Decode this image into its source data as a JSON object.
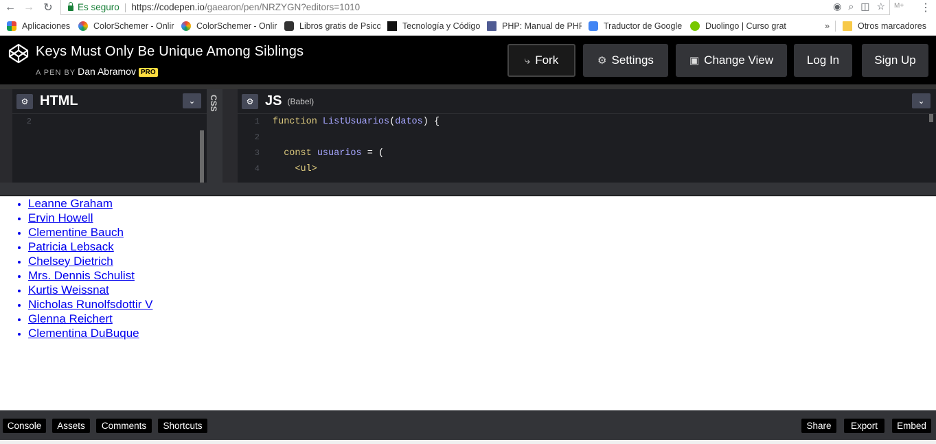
{
  "browser": {
    "secure_label": "Es seguro",
    "url_host": "https://codepen.io",
    "url_path": "/gaearon/pen/NRZYGN?editors=1010",
    "bookmarks": [
      {
        "label": "Aplicaciones",
        "color": "#e8453c"
      },
      {
        "label": "ColorSchemer - Onlir",
        "color": "#f4b400"
      },
      {
        "label": "ColorSchemer - Onlir",
        "color": "#f4b400"
      },
      {
        "label": "Libros gratis de Psico",
        "color": "#333333"
      },
      {
        "label": "Tecnología y Código",
        "color": "#111111"
      },
      {
        "label": "PHP: Manual de PHP",
        "color": "#4f5b93"
      },
      {
        "label": "Traductor de Google",
        "color": "#4285f4"
      },
      {
        "label": "Duolingo | Curso grat",
        "color": "#78c800"
      }
    ],
    "more_bookmarks": "»",
    "other_bookmarks": "Otros marcadores"
  },
  "header": {
    "title": "Keys Must Only Be Unique Among Siblings",
    "by_label": "A PEN BY",
    "author": "Dan Abramov",
    "pro_badge": "PRO",
    "buttons": {
      "fork": "Fork",
      "settings": "Settings",
      "change_view": "Change View",
      "login": "Log In",
      "signup": "Sign Up"
    }
  },
  "editors": {
    "html": {
      "title": "HTML",
      "line_numbers": [
        "2"
      ]
    },
    "css": {
      "title": "CSS"
    },
    "js": {
      "title": "JS",
      "preprocessor": "(Babel)",
      "lines": [
        {
          "n": "1",
          "kw": "function",
          "name": "ListUsuarios",
          "param": "datos",
          "rest": ") {"
        },
        {
          "n": "2"
        },
        {
          "n": "3",
          "kw": "const",
          "name": "usuarios",
          "rest": " = ("
        },
        {
          "n": "4",
          "tag": "<ul>"
        }
      ]
    }
  },
  "preview": {
    "users": [
      "Leanne Graham",
      "Ervin Howell",
      "Clementine Bauch",
      "Patricia Lebsack",
      "Chelsey Dietrich",
      "Mrs. Dennis Schulist",
      "Kurtis Weissnat",
      "Nicholas Runolfsdottir V",
      "Glenna Reichert",
      "Clementina DuBuque"
    ]
  },
  "footer": {
    "left": [
      "Console",
      "Assets",
      "Comments",
      "Shortcuts"
    ],
    "right": [
      "Share",
      "Export",
      "Embed"
    ]
  }
}
